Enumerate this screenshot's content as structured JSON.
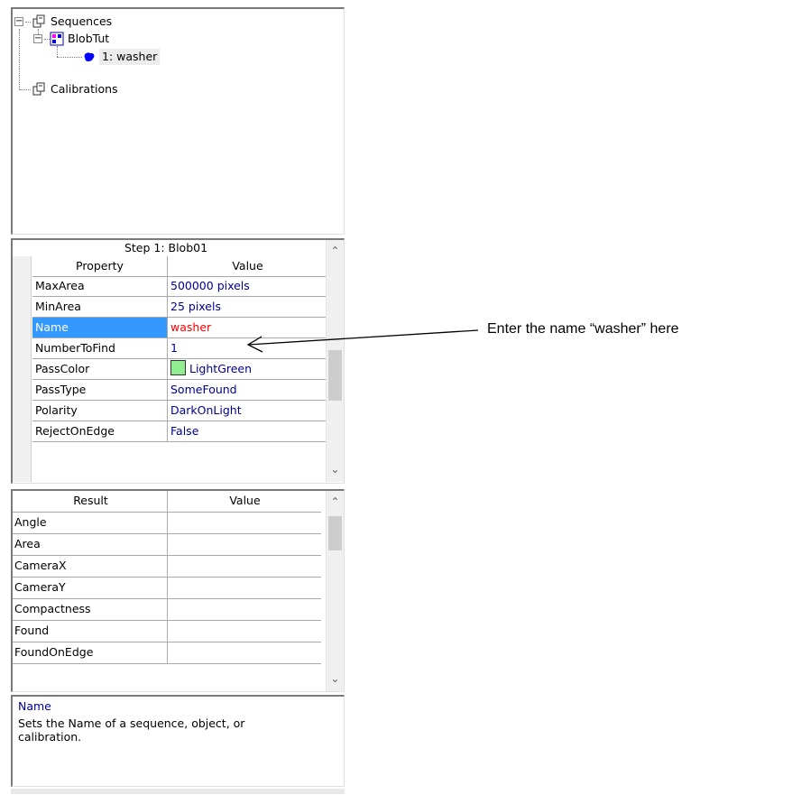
{
  "tree": {
    "root_label": "Sequences",
    "sequence_label": "BlobTut",
    "object_label": "1: washer",
    "calibrations_label": "Calibrations",
    "expander_symbol": "−"
  },
  "properties": {
    "title": "Step 1: Blob01",
    "col_property": "Property",
    "col_value": "Value",
    "rows": [
      {
        "name": "MaxArea",
        "value": "500000 pixels"
      },
      {
        "name": "MinArea",
        "value": "25 pixels"
      },
      {
        "name": "Name",
        "value": "washer"
      },
      {
        "name": "NumberToFind",
        "value": "1"
      },
      {
        "name": "PassColor",
        "value": "LightGreen"
      },
      {
        "name": "PassType",
        "value": "SomeFound"
      },
      {
        "name": "Polarity",
        "value": "DarkOnLight"
      },
      {
        "name": "RejectOnEdge",
        "value": "False"
      }
    ],
    "pass_color_hex": "#90ee90",
    "selected_color_hex": "#3399ff"
  },
  "results": {
    "col_result": "Result",
    "col_value": "Value",
    "rows": [
      {
        "name": "Angle",
        "value": ""
      },
      {
        "name": "Area",
        "value": ""
      },
      {
        "name": "CameraX",
        "value": ""
      },
      {
        "name": "CameraY",
        "value": ""
      },
      {
        "name": "Compactness",
        "value": ""
      },
      {
        "name": "Found",
        "value": ""
      },
      {
        "name": "FoundOnEdge",
        "value": ""
      }
    ]
  },
  "description": {
    "title": "Name",
    "text": "Sets the Name of a sequence, object, or calibration."
  },
  "scroll": {
    "up": "⌃",
    "down": "⌄"
  },
  "annotation": {
    "text": "Enter the name “washer” here"
  }
}
